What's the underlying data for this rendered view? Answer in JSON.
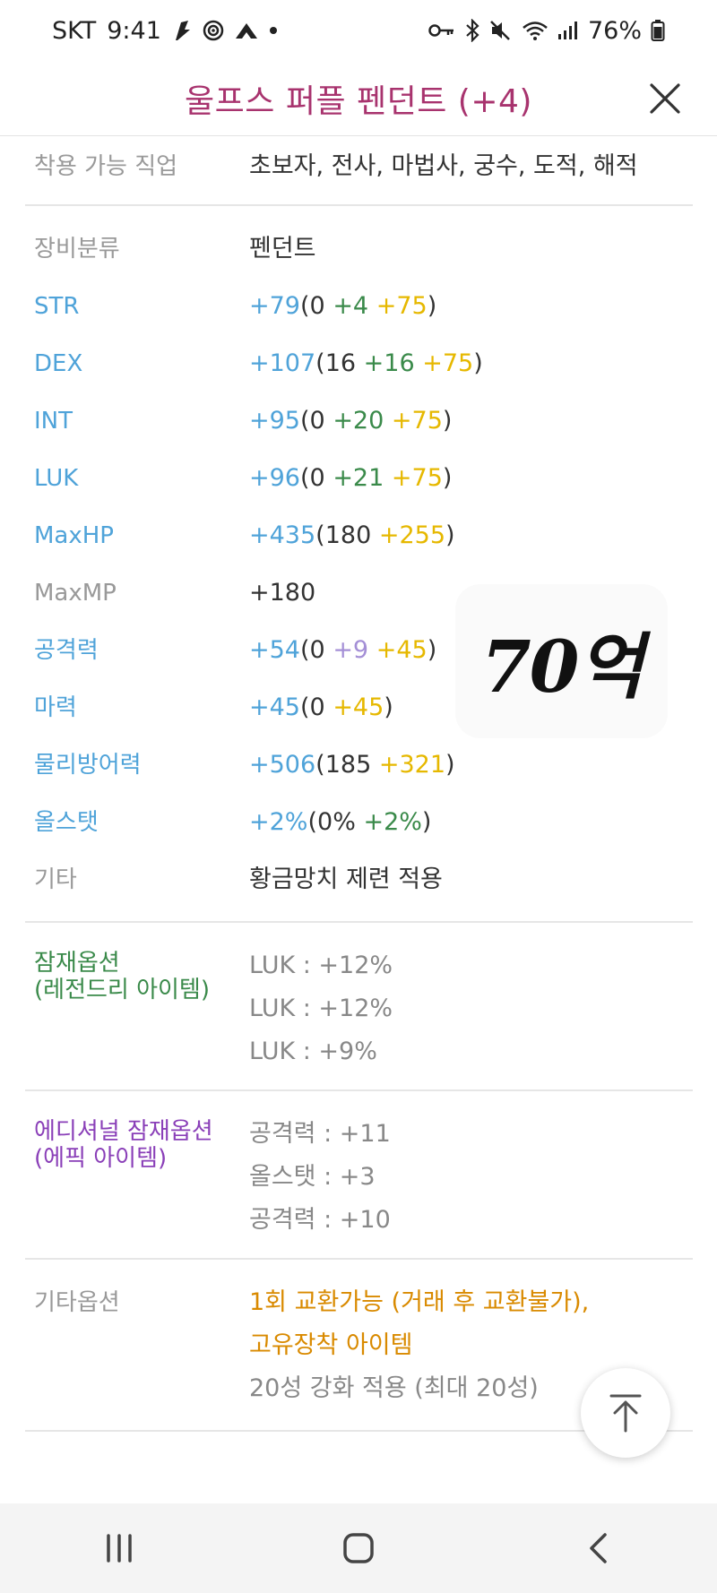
{
  "status_bar": {
    "carrier": "SKT",
    "time": "9:41",
    "battery": "76%"
  },
  "header": {
    "title": "울프스 퍼플 펜던트 (+4)"
  },
  "job_row": {
    "label": "착용 가능 직업",
    "value": "초보자, 전사, 마법사, 궁수, 도적, 해적"
  },
  "category_row": {
    "label": "장비분류",
    "value": "펜던트"
  },
  "stats": [
    {
      "label": "STR",
      "total": "+79",
      "open": "(",
      "base": "0",
      "scroll": "+4",
      "star": "+75",
      "close": ")"
    },
    {
      "label": "DEX",
      "total": "+107",
      "open": "(",
      "base": "16",
      "scroll": "+16",
      "star": "+75",
      "close": ")"
    },
    {
      "label": "INT",
      "total": "+95",
      "open": "(",
      "base": "0",
      "scroll": "+20",
      "star": "+75",
      "close": ")"
    },
    {
      "label": "LUK",
      "total": "+96",
      "open": "(",
      "base": "0",
      "scroll": "+21",
      "star": "+75",
      "close": ")"
    },
    {
      "label": "MaxHP",
      "total": "+435",
      "open": "(",
      "base": "180",
      "star": "+255",
      "close": ")"
    },
    {
      "label": "MaxMP",
      "value": "+180"
    },
    {
      "label": "공격력",
      "total": "+54",
      "open": "(",
      "base": "0",
      "upgrade": "+9",
      "star": "+45",
      "close": ")"
    },
    {
      "label": "마력",
      "total": "+45",
      "open": "(",
      "base": "0",
      "star": "+45",
      "close": ")"
    },
    {
      "label": "물리방어력",
      "total": "+506",
      "open": "(",
      "base": "185",
      "star": "+321",
      "close": ")"
    },
    {
      "label": "올스탯",
      "total": "+2%",
      "open": "(",
      "base": "0%",
      "scroll": "+2%",
      "close": ")"
    },
    {
      "label": "기타",
      "value": "황금망치 제련 적용"
    }
  ],
  "price_badge": "70억",
  "potential": {
    "label_line1": "잠재옵션",
    "label_line2": "(레전드리 아이템)",
    "lines": [
      "LUK : +12%",
      "LUK : +12%",
      "LUK : +9%"
    ]
  },
  "additional_potential": {
    "label_line1": "에디셔널 잠재옵션",
    "label_line2": "(에픽 아이템)",
    "lines": [
      "공격력 : +11",
      "올스탯 : +3",
      "공격력 : +10"
    ]
  },
  "etc_options": {
    "label": "기타옵션",
    "line1": "1회 교환가능 (거래 후 교환불가),",
    "line2": "고유장착 아이템",
    "line3": "20성 강화 적용 (최대 20성)"
  },
  "colors": {
    "title": "#a8336e",
    "blue": "#4fa3d9",
    "green": "#3a8a4a",
    "yellow": "#e6b800",
    "purple": "#8a3fb8",
    "orange": "#d98a00"
  }
}
